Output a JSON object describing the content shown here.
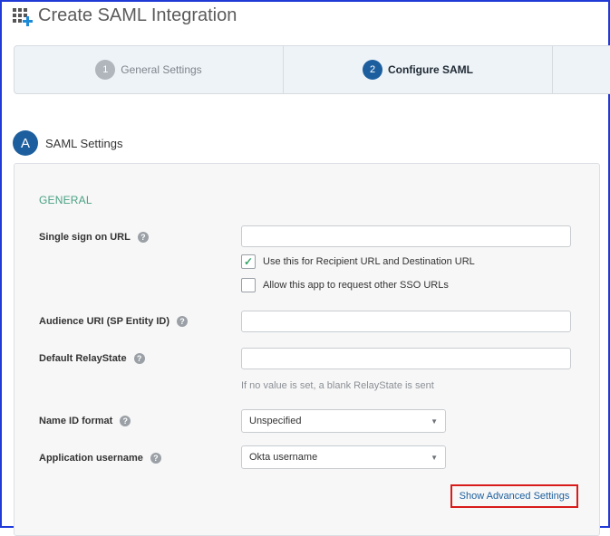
{
  "header": {
    "title": "Create SAML Integration",
    "icon": "app-grid-add-icon"
  },
  "steps": [
    {
      "num": "1",
      "label": "General Settings",
      "state": "done"
    },
    {
      "num": "2",
      "label": "Configure SAML",
      "state": "active"
    }
  ],
  "section": {
    "badge": "A",
    "title": "SAML Settings"
  },
  "general": {
    "heading": "GENERAL"
  },
  "fields": {
    "sso_url": {
      "label": "Single sign on URL",
      "value": ""
    },
    "recipient_check": {
      "label": "Use this for Recipient URL and Destination URL",
      "checked": true
    },
    "other_sso_check": {
      "label": "Allow this app to request other SSO URLs",
      "checked": false
    },
    "audience": {
      "label": "Audience URI (SP Entity ID)",
      "value": ""
    },
    "relay": {
      "label": "Default RelayState",
      "value": "",
      "hint": "If no value is set, a blank RelayState is sent"
    },
    "nameid": {
      "label": "Name ID format",
      "value": "Unspecified"
    },
    "username": {
      "label": "Application username",
      "value": "Okta username"
    }
  },
  "help_glyph": "?",
  "advanced_link": "Show Advanced Settings",
  "colors": {
    "accent": "#1d5f9e",
    "general": "#4aa184",
    "highlight": "#d81b1b",
    "frame": "#1f3ad6"
  }
}
